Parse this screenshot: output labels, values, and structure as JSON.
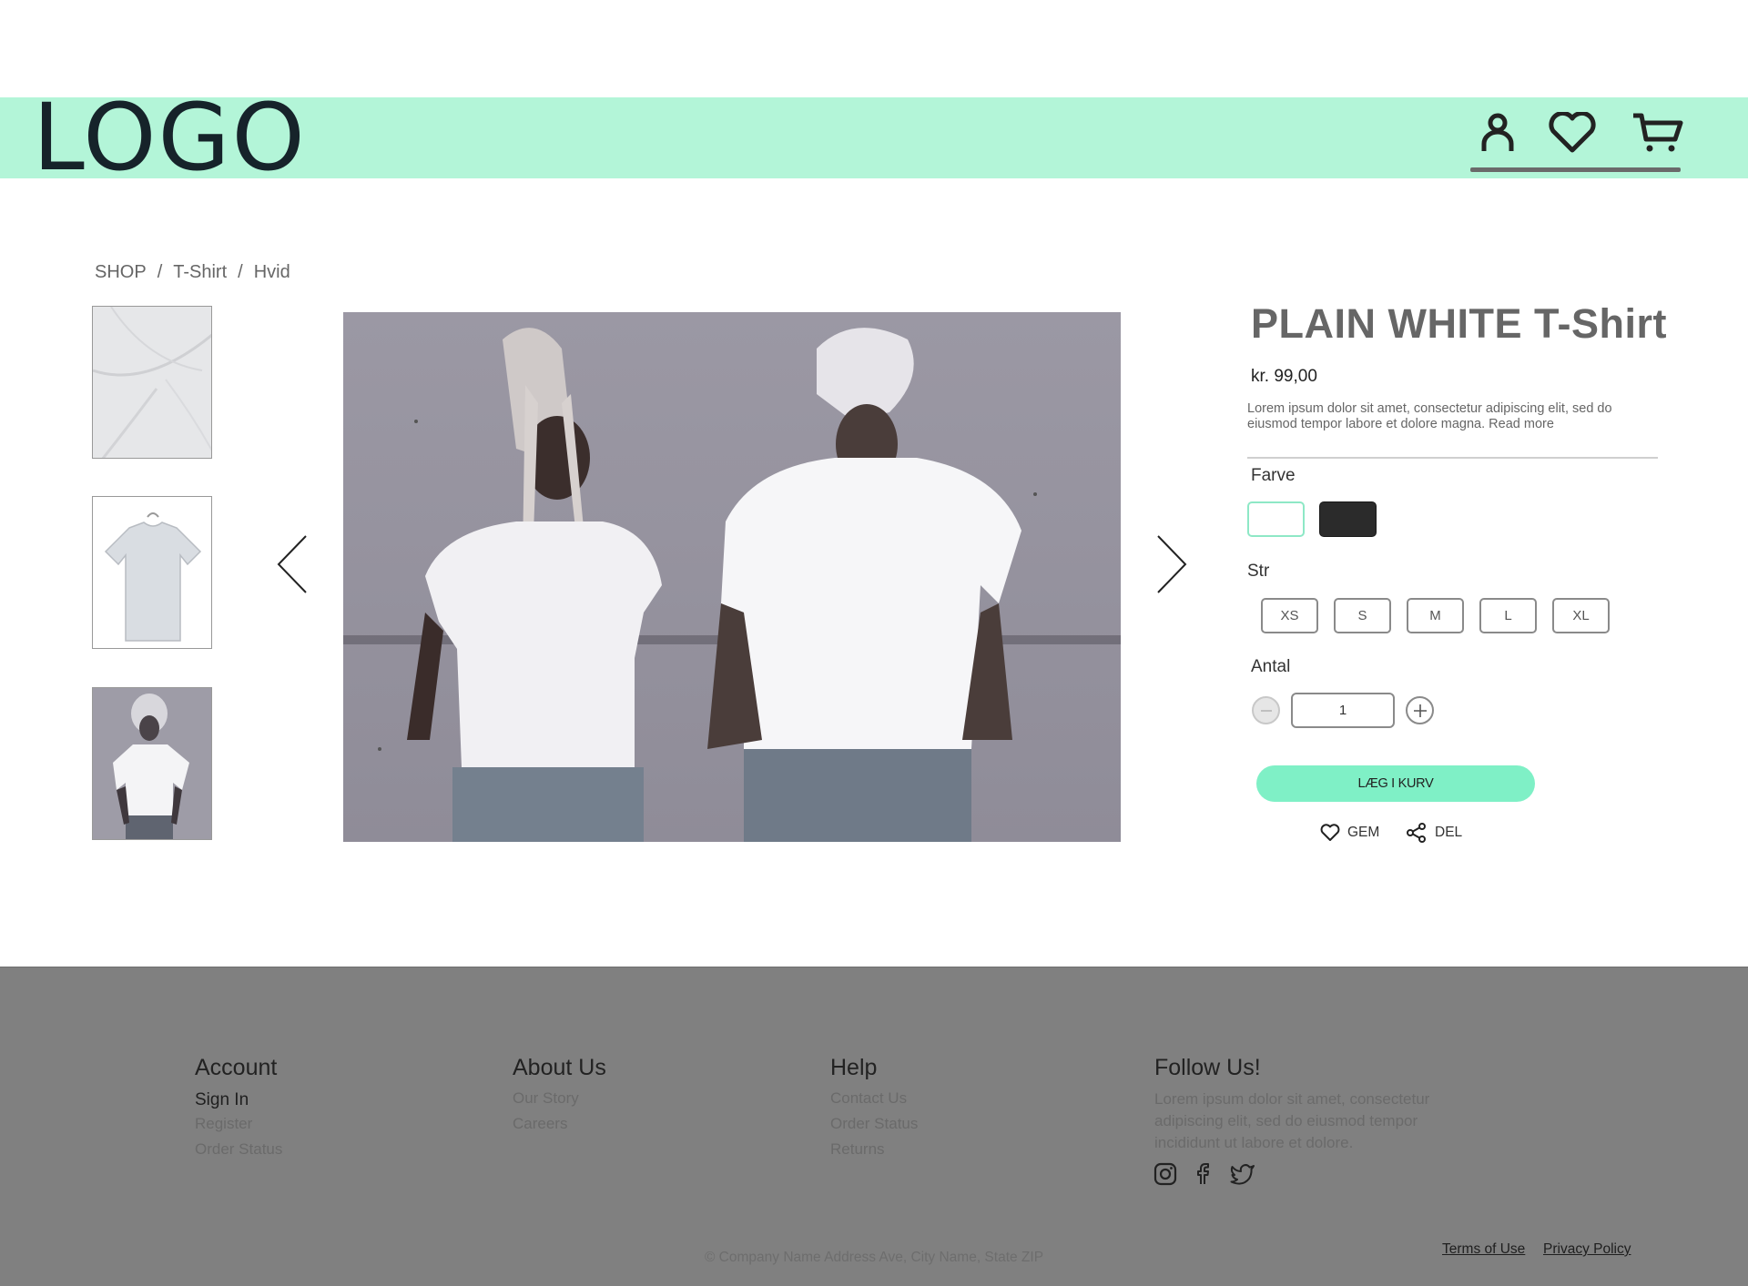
{
  "header": {
    "logo": "LOGO",
    "icons": [
      "user-icon",
      "heart-icon",
      "cart-icon"
    ],
    "background": "#b3f5d8"
  },
  "breadcrumb": [
    "SHOP",
    "T-Shirt",
    "Hvid"
  ],
  "gallery": {
    "thumbnails": [
      "fabric-closeup",
      "tshirt-on-hanger",
      "model-wearing-tshirt"
    ],
    "main_image": "two-models-in-white-tshirts"
  },
  "product": {
    "title": "PLAIN WHITE T-Shirt",
    "price": "kr. 99,00",
    "description": "Lorem ipsum dolor sit amet, consectetur adipiscing elit, sed do eiusmod tempor labore et dolore magna. Read more",
    "color_label": "Farve",
    "colors": [
      {
        "name": "white",
        "hex": "#ffffff",
        "selected": true
      },
      {
        "name": "black",
        "hex": "#2b2b2b",
        "selected": false
      }
    ],
    "size_label": "Str",
    "sizes": [
      "XS",
      "S",
      "M",
      "L",
      "XL"
    ],
    "quantity_label": "Antal",
    "quantity": "1",
    "add_to_cart": "LÆG I KURV",
    "save_label": "GEM",
    "share_label": "DEL",
    "accent": "#7ff0c6"
  },
  "footer": {
    "columns": [
      {
        "heading": "Account",
        "links": [
          "Sign In",
          "Register",
          "Order Status"
        ]
      },
      {
        "heading": "About Us",
        "links": [
          "Our Story",
          "Careers"
        ]
      },
      {
        "heading": "Help",
        "links": [
          "Contact Us",
          "Order Status",
          "Returns"
        ]
      },
      {
        "heading": "Follow Us!",
        "text": "Lorem ipsum dolor sit amet, consectetur adipiscing elit, sed do eiusmod tempor incididunt ut labore et dolore."
      }
    ],
    "social_icons": [
      "instagram-icon",
      "facebook-icon",
      "twitter-icon"
    ],
    "copyright": "© Company Name Address Ave, City Name, State ZIP",
    "legal": [
      "Terms of Use",
      "Privacy Policy"
    ]
  }
}
